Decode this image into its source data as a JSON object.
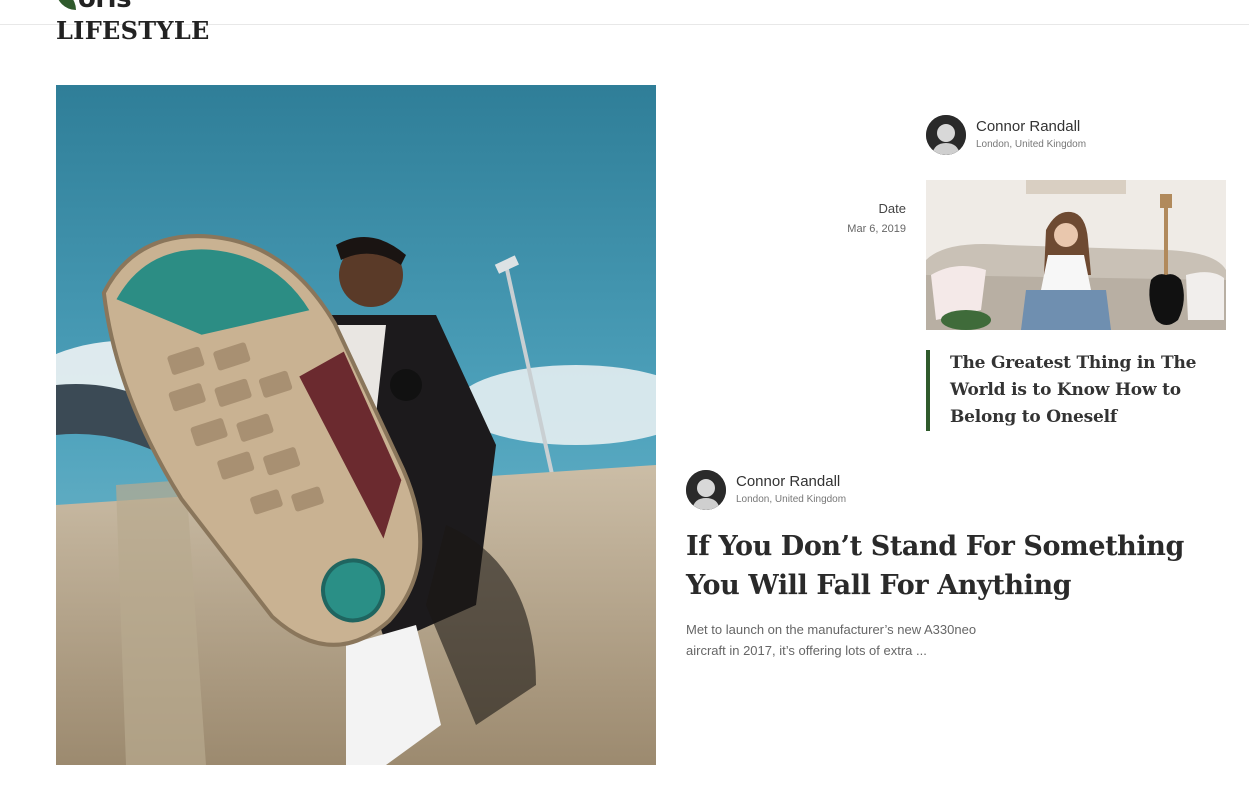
{
  "brand": {
    "logo_text": "oris",
    "accent_color": "#2f5a2c"
  },
  "section": {
    "title": "LIFESTYLE"
  },
  "hero": {
    "image": "photo-person-sneaker-sole-skatepark"
  },
  "card_small": {
    "author_name": "Connor Randall",
    "author_location": "London, United Kingdom",
    "date_label": "Date",
    "date_value": "Mar 6, 2019",
    "image": "photo-woman-on-sofa-with-guitar",
    "title": "The Greatest Thing in The World is to Know How to Belong to Oneself"
  },
  "card_large": {
    "author_name": "Connor Randall",
    "author_location": "London, United Kingdom",
    "title": "If You Don’t Stand For Something You Will Fall For Anything",
    "excerpt": "Met to launch on the manufacturer’s new A330neo aircraft in 2017, it’s offering lots of extra ..."
  }
}
